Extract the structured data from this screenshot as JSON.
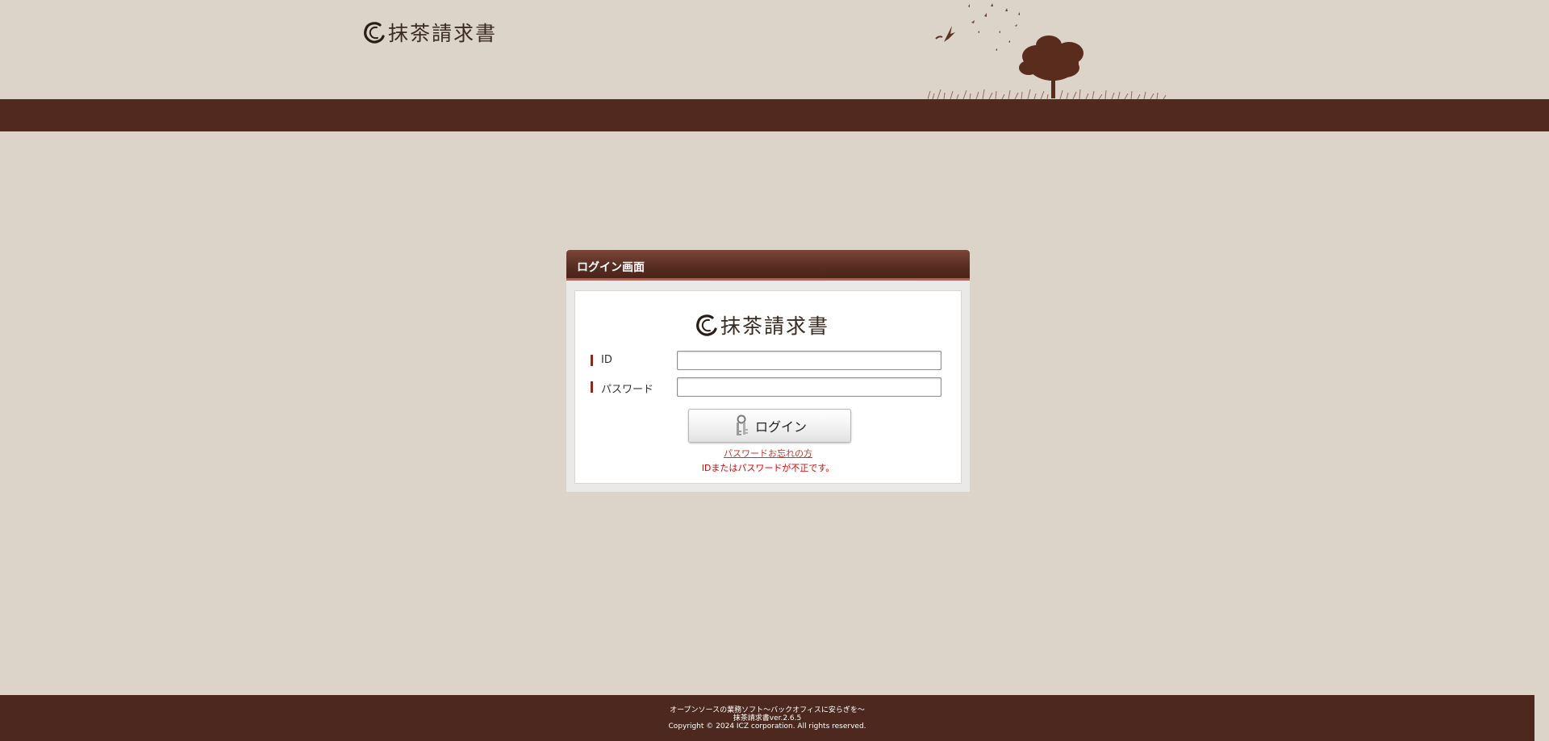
{
  "app": {
    "name": "抹茶請求書"
  },
  "colors": {
    "background": "#dcd4c9",
    "brand_brown": "#52291e",
    "accent_red": "#c25a4e",
    "error_red": "#e00000"
  },
  "icons": {
    "logo": "enso-circle-icon",
    "login_button": "keys-icon",
    "scenery": "tree-and-birds-illustration"
  },
  "login": {
    "panel_title": "ログイン画面",
    "id_label": "ID",
    "id_value": "",
    "password_label": "パスワード",
    "password_value": "",
    "button_label": "ログイン",
    "forgot_link": "パスワードお忘れの方",
    "error_message": "IDまたはパスワードが不正です。"
  },
  "footer": {
    "tagline": "オープンソースの業務ソフト～バックオフィスに安らぎを～",
    "version": "抹茶請求書ver.2.6.5",
    "copyright": "Copyright © 2024 ICZ corporation. All rights reserved."
  }
}
